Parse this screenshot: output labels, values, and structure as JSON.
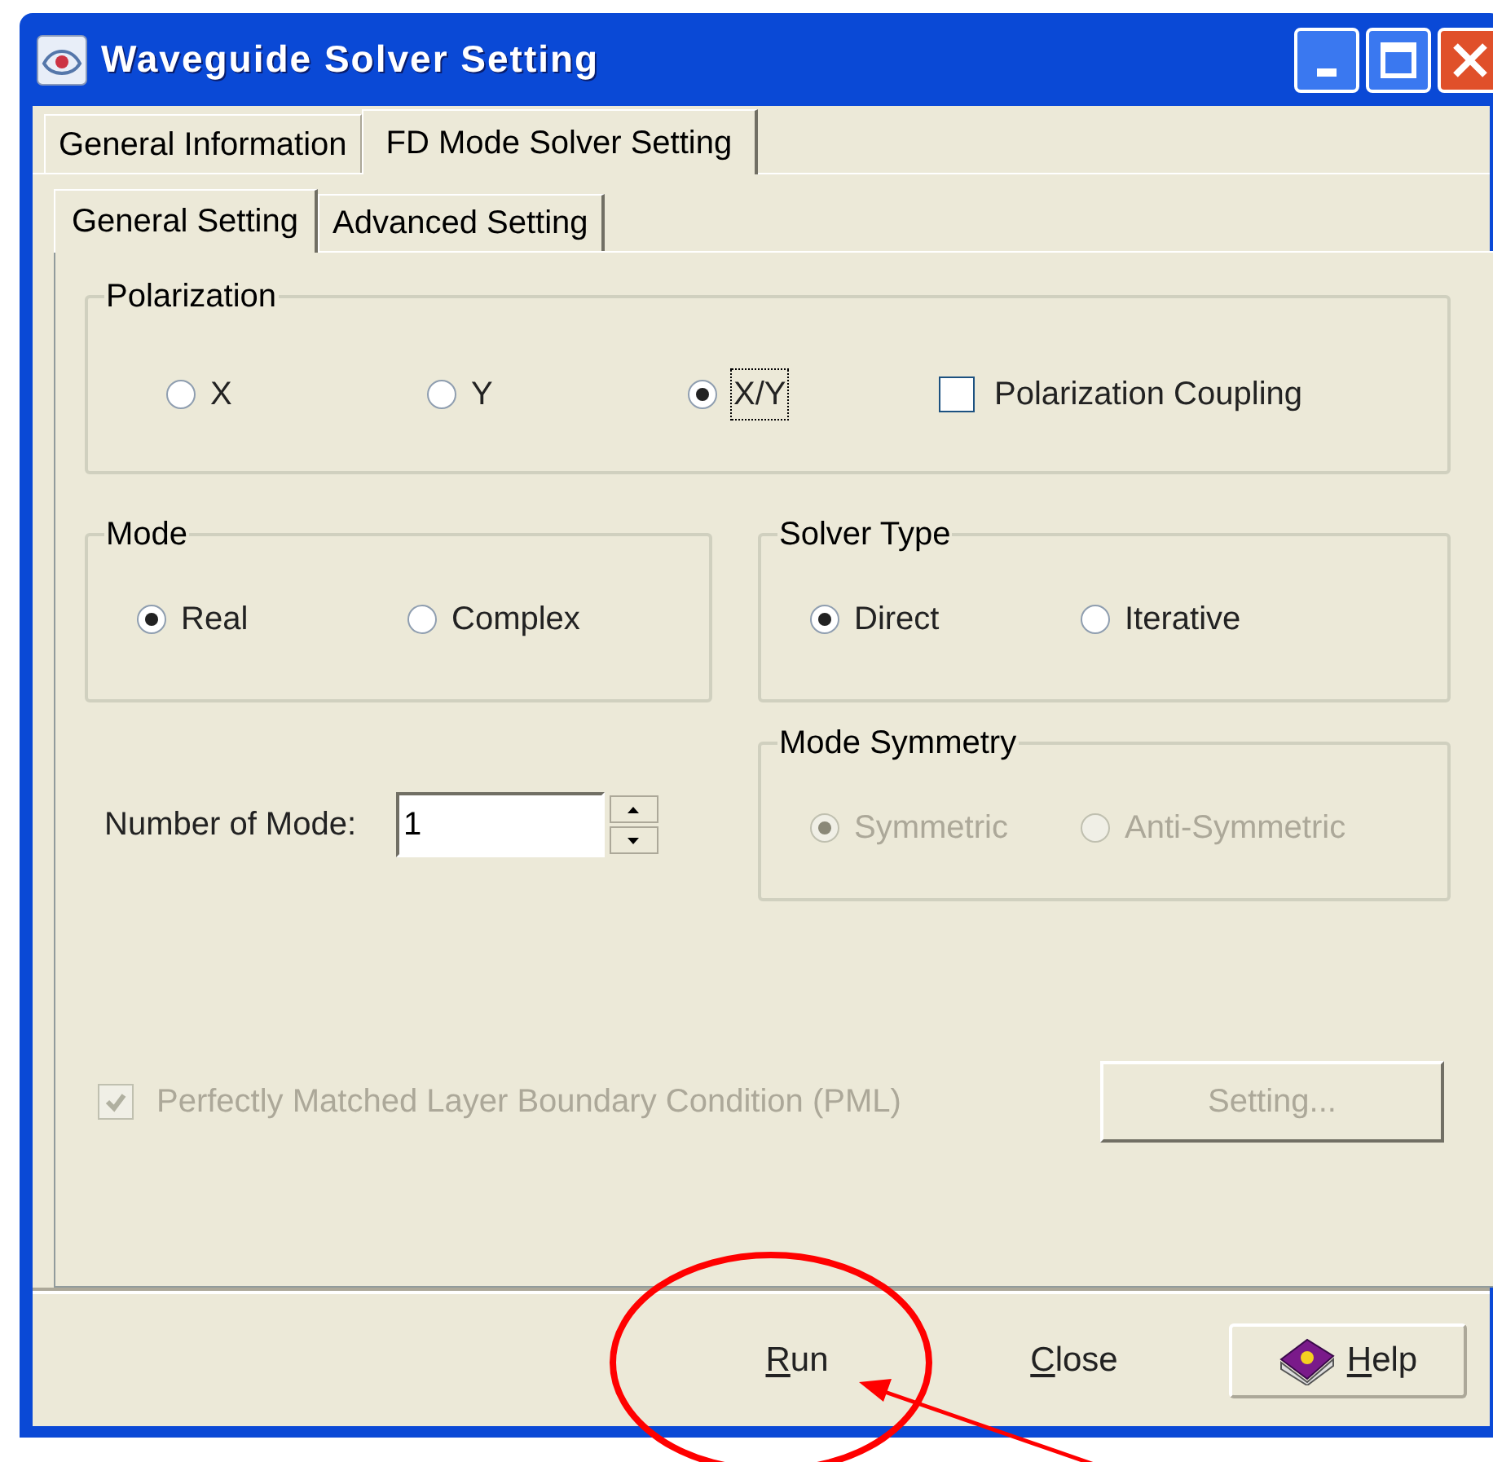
{
  "window": {
    "title": "Waveguide Solver Setting"
  },
  "tabs": [
    {
      "label": "General Information",
      "selected": false
    },
    {
      "label": "FD Mode Solver Setting",
      "selected": true
    }
  ],
  "subtabs": [
    {
      "label": "General Setting",
      "selected": true
    },
    {
      "label": "Advanced Setting",
      "selected": false
    }
  ],
  "polarization": {
    "title": "Polarization",
    "options": [
      {
        "label": "X",
        "selected": false
      },
      {
        "label": "Y",
        "selected": false
      },
      {
        "label": "X/Y",
        "selected": true,
        "focused": true
      }
    ],
    "coupling": {
      "label": "Polarization Coupling",
      "checked": false
    }
  },
  "mode": {
    "title": "Mode",
    "options": [
      {
        "label": "Real",
        "selected": true
      },
      {
        "label": "Complex",
        "selected": false
      }
    ]
  },
  "solver_type": {
    "title": "Solver Type",
    "options": [
      {
        "label": "Direct",
        "selected": true
      },
      {
        "label": "Iterative",
        "selected": false
      }
    ]
  },
  "number_of_mode": {
    "label": "Number of Mode:",
    "value": "1"
  },
  "mode_symmetry": {
    "title": "Mode Symmetry",
    "disabled": true,
    "options": [
      {
        "label": "Symmetric",
        "selected": true
      },
      {
        "label": "Anti-Symmetric",
        "selected": false
      }
    ]
  },
  "pml": {
    "label": "Perfectly Matched Layer Boundary Condition (PML)",
    "checked": true,
    "disabled": true
  },
  "setting_button": {
    "label": "Setting...",
    "disabled": true
  },
  "buttons": [
    {
      "kind": "flat",
      "label": "Run"
    },
    {
      "kind": "flat",
      "label": "Close"
    },
    {
      "kind": "help",
      "label": "Help"
    }
  ]
}
